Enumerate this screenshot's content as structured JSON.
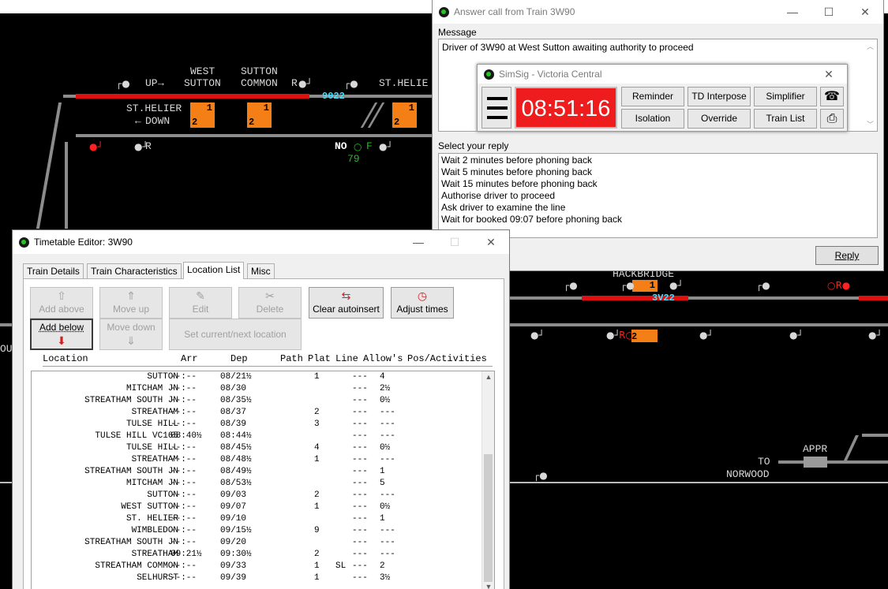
{
  "panel": {
    "labels": {
      "west_sutton": [
        "WEST",
        "SUTTON"
      ],
      "sutton_common": [
        "SUTTON",
        "COMMON"
      ],
      "up": "UP",
      "st_helier_top": "ST.HELIE",
      "st_helier_down": [
        "ST.HELIER",
        "DOWN"
      ],
      "hackbridge": "HACKBRIDGE",
      "appr": "APPR",
      "to_norwood": [
        "TO",
        "NORWOOD"
      ],
      "r1": "R",
      "r2": "R",
      "no": "NO",
      "f": "F",
      "num79": "79",
      "ou": "OU"
    },
    "td_numbers": [
      "9022",
      "3V22"
    ],
    "berths": [
      {
        "top": "1",
        "bottom": "2"
      },
      {
        "top": "1",
        "bottom": "2"
      },
      {
        "top": "1",
        "bottom": "2"
      },
      {
        "top": "1",
        "bottom": ""
      },
      {
        "top": "2",
        "bottom": ""
      }
    ],
    "colors": {
      "track": "#8c8c8c",
      "route_set": "#e01010",
      "berth": "#f57f17",
      "td": "#40e0ff"
    }
  },
  "answer_call": {
    "title": "Answer call from Train 3W90",
    "message_label": "Message",
    "message": "Driver of 3W90 at West Sutton awaiting authority to proceed",
    "reply_label": "Select your reply",
    "replies": [
      "Wait 2 minutes before phoning back",
      "Wait 5 minutes before phoning back",
      "Wait 15 minutes before phoning back",
      "Authorise driver to proceed",
      "Ask driver to examine the line",
      "Wait for booked 09:07 before phoning back"
    ],
    "reply_button": "Reply",
    "icons": {
      "minimize": "—",
      "maximize": "☐",
      "close": "✕"
    }
  },
  "simsig": {
    "title": "SimSig - Victoria Central",
    "clock": "08:51:16",
    "buttons": [
      "Reminder",
      "TD Interpose",
      "Simplifier",
      "Isolation",
      "Override",
      "Train List"
    ],
    "icons": {
      "phone": "☎",
      "printer": "⎙",
      "close": "✕"
    }
  },
  "timetable": {
    "title": "Timetable Editor: 3W90",
    "tabs": [
      "Train Details",
      "Train Characteristics",
      "Location List",
      "Misc"
    ],
    "active_tab": "Location List",
    "buttons": {
      "add_above": "Add above",
      "move_up": "Move up",
      "edit": "Edit",
      "delete": "Delete",
      "clear_autoinsert": "Clear autoinsert",
      "adjust_times": "Adjust times",
      "add_below": "Add below",
      "move_down": "Move down",
      "set_current": "Set current/next location"
    },
    "columns": {
      "location": "Location",
      "arr": "Arr",
      "dep": "Dep",
      "path": "Path",
      "plat": "Plat",
      "line": "Line",
      "allows": "Allow's",
      "pos": "Pos/Activities"
    },
    "rows": [
      {
        "loc": "SUTTON",
        "arr": "--:--",
        "dep": "08/21½",
        "plat": "1",
        "line": "",
        "allow": "---",
        "pos": "4"
      },
      {
        "loc": "MITCHAM JN",
        "arr": "--:--",
        "dep": "08/30",
        "plat": "",
        "line": "",
        "allow": "---",
        "pos": "2½"
      },
      {
        "loc": "STREATHAM SOUTH JN",
        "arr": "--:--",
        "dep": "08/35½",
        "plat": "",
        "line": "",
        "allow": "---",
        "pos": "0½"
      },
      {
        "loc": "STREATHAM",
        "arr": "--:--",
        "dep": "08/37",
        "plat": "2",
        "line": "",
        "allow": "---",
        "pos": "---"
      },
      {
        "loc": "TULSE HILL",
        "arr": "--:--",
        "dep": "08/39",
        "plat": "3",
        "line": "",
        "allow": "---",
        "pos": "---"
      },
      {
        "loc": "TULSE HILL VC165",
        "arr": "08:40½",
        "dep": "08:44½",
        "plat": "",
        "line": "",
        "allow": "---",
        "pos": "---"
      },
      {
        "loc": "TULSE HILL",
        "arr": "--:--",
        "dep": "08/45½",
        "plat": "4",
        "line": "",
        "allow": "---",
        "pos": "0½"
      },
      {
        "loc": "STREATHAM",
        "arr": "--:--",
        "dep": "08/48½",
        "plat": "1",
        "line": "",
        "allow": "---",
        "pos": "---"
      },
      {
        "loc": "STREATHAM SOUTH JN",
        "arr": "--:--",
        "dep": "08/49½",
        "plat": "",
        "line": "",
        "allow": "---",
        "pos": "1"
      },
      {
        "loc": "MITCHAM JN",
        "arr": "--:--",
        "dep": "08/53½",
        "plat": "",
        "line": "",
        "allow": "---",
        "pos": "5"
      },
      {
        "loc": "SUTTON",
        "arr": "--:--",
        "dep": "09/03",
        "plat": "2",
        "line": "",
        "allow": "---",
        "pos": "---"
      },
      {
        "loc": "WEST SUTTON",
        "arr": "--:--",
        "dep": "09/07",
        "plat": "1",
        "line": "",
        "allow": "---",
        "pos": "0½"
      },
      {
        "loc": "ST. HELIER",
        "arr": "--:--",
        "dep": "09/10",
        "plat": "",
        "line": "",
        "allow": "---",
        "pos": "1"
      },
      {
        "loc": "WIMBLEDON",
        "arr": "--:--",
        "dep": "09/15½",
        "plat": "9",
        "line": "",
        "allow": "---",
        "pos": "---"
      },
      {
        "loc": "STREATHAM SOUTH JN",
        "arr": "--:--",
        "dep": "09/20",
        "plat": "",
        "line": "",
        "allow": "---",
        "pos": "---"
      },
      {
        "loc": "STREATHAM",
        "arr": "09:21½",
        "dep": "09:30½",
        "plat": "2",
        "line": "",
        "allow": "---",
        "pos": "---"
      },
      {
        "loc": "STREATHAM COMMON",
        "arr": "--:--",
        "dep": "09/33",
        "plat": "1",
        "line": "SL",
        "allow": "---",
        "pos": "2"
      },
      {
        "loc": "SELHURST",
        "arr": "--:--",
        "dep": "09/39",
        "plat": "1",
        "line": "",
        "allow": "---",
        "pos": "3½"
      }
    ],
    "icons": {
      "minimize": "—",
      "maximize": "☐",
      "close": "✕"
    }
  }
}
